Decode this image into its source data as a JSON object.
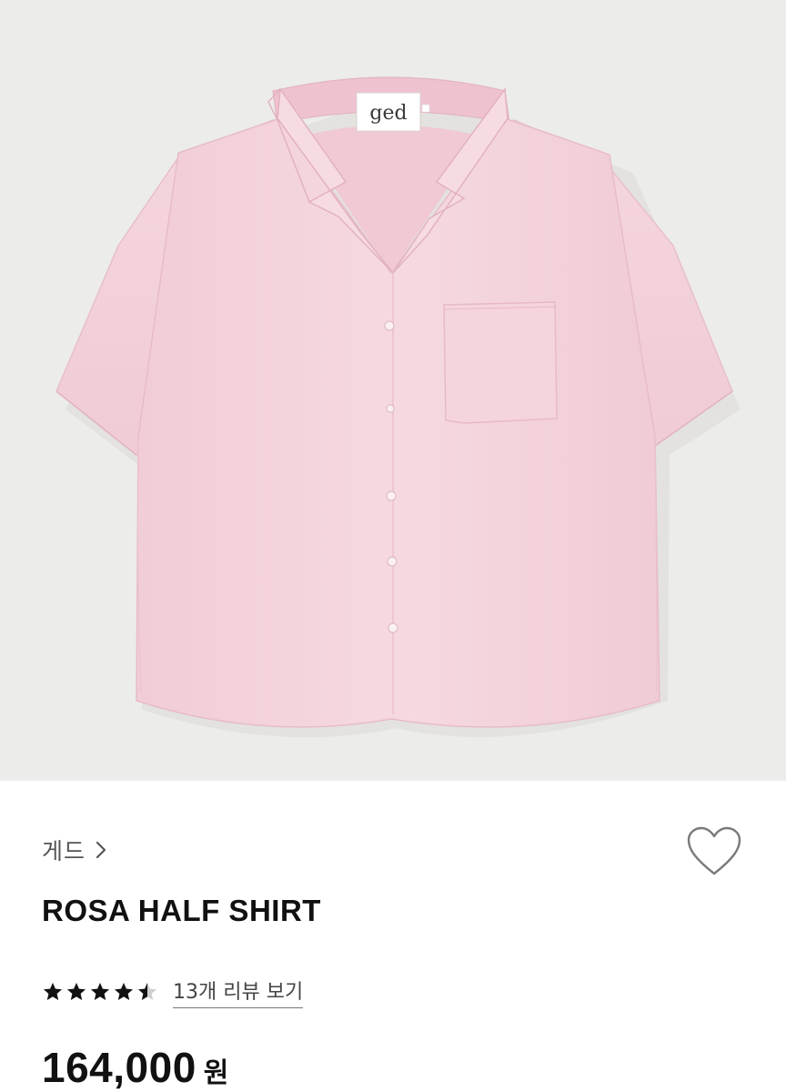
{
  "product_image": {
    "label_text": "ged",
    "background_color": "#ececea",
    "garment_color": "#f4d4dc"
  },
  "product": {
    "brand": "게드",
    "brand_chevron_icon": "chevron-right-icon",
    "wishlist_icon": "heart-outline-icon",
    "name": "ROSA HALF SHIRT",
    "rating": 4.5,
    "rating_max": 5,
    "review_link": "13개 리뷰 보기",
    "price": "164,000",
    "currency": "원"
  }
}
